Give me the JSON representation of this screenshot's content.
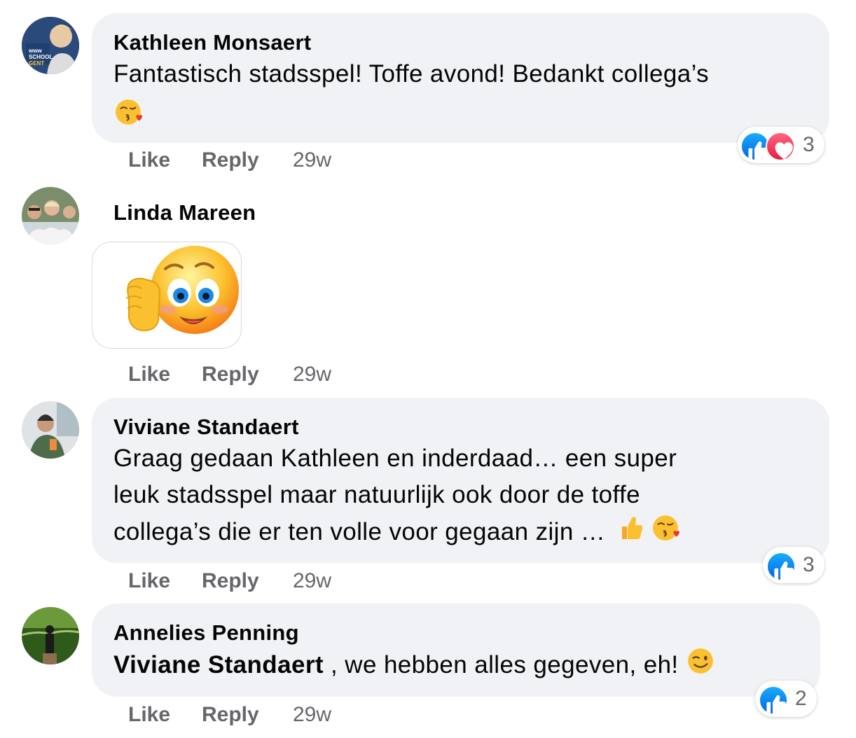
{
  "comments": [
    {
      "author": "Kathleen Monsaert",
      "line1": "Fantastisch stadsspel! Toffe avond! Bedankt collega’s",
      "emoji": "kissing-heart-emoji",
      "avatar_text": [
        "www",
        "SCHOOL",
        "GENT"
      ],
      "actions": {
        "like": "Like",
        "reply": "Reply",
        "time": "29w"
      },
      "reactions": {
        "icons": [
          "like-icon",
          "heart-icon"
        ],
        "count": "3"
      }
    },
    {
      "author": "Linda Mareen",
      "sticker": "waving-smiley-sticker",
      "actions": {
        "like": "Like",
        "reply": "Reply",
        "time": "29w"
      }
    },
    {
      "author": "Viviane Standaert",
      "lines": [
        "Graag gedaan Kathleen en inderdaad… een super",
        "leuk stadsspel maar natuurlijk ook door de toffe",
        "collega’s die er ten volle voor gegaan zijn …"
      ],
      "emojis": [
        "thumbs-up-emoji",
        "kissing-heart-emoji"
      ],
      "actions": {
        "like": "Like",
        "reply": "Reply",
        "time": "29w"
      },
      "reactions": {
        "icons": [
          "like-icon"
        ],
        "count": "3"
      }
    },
    {
      "author": "Annelies Penning",
      "mention": "Viviane Standaert",
      "text": " , we hebben alles gegeven, eh!",
      "emoji": "winking-emoji",
      "actions": {
        "like": "Like",
        "reply": "Reply",
        "time": "29w"
      },
      "reactions": {
        "icons": [
          "like-icon"
        ],
        "count": "2"
      }
    }
  ],
  "colors": {
    "bubble": "#f0f2f5",
    "secondary_text": "#65676b",
    "like_blue": "#1877f2",
    "heart_red": "#f33e58"
  }
}
